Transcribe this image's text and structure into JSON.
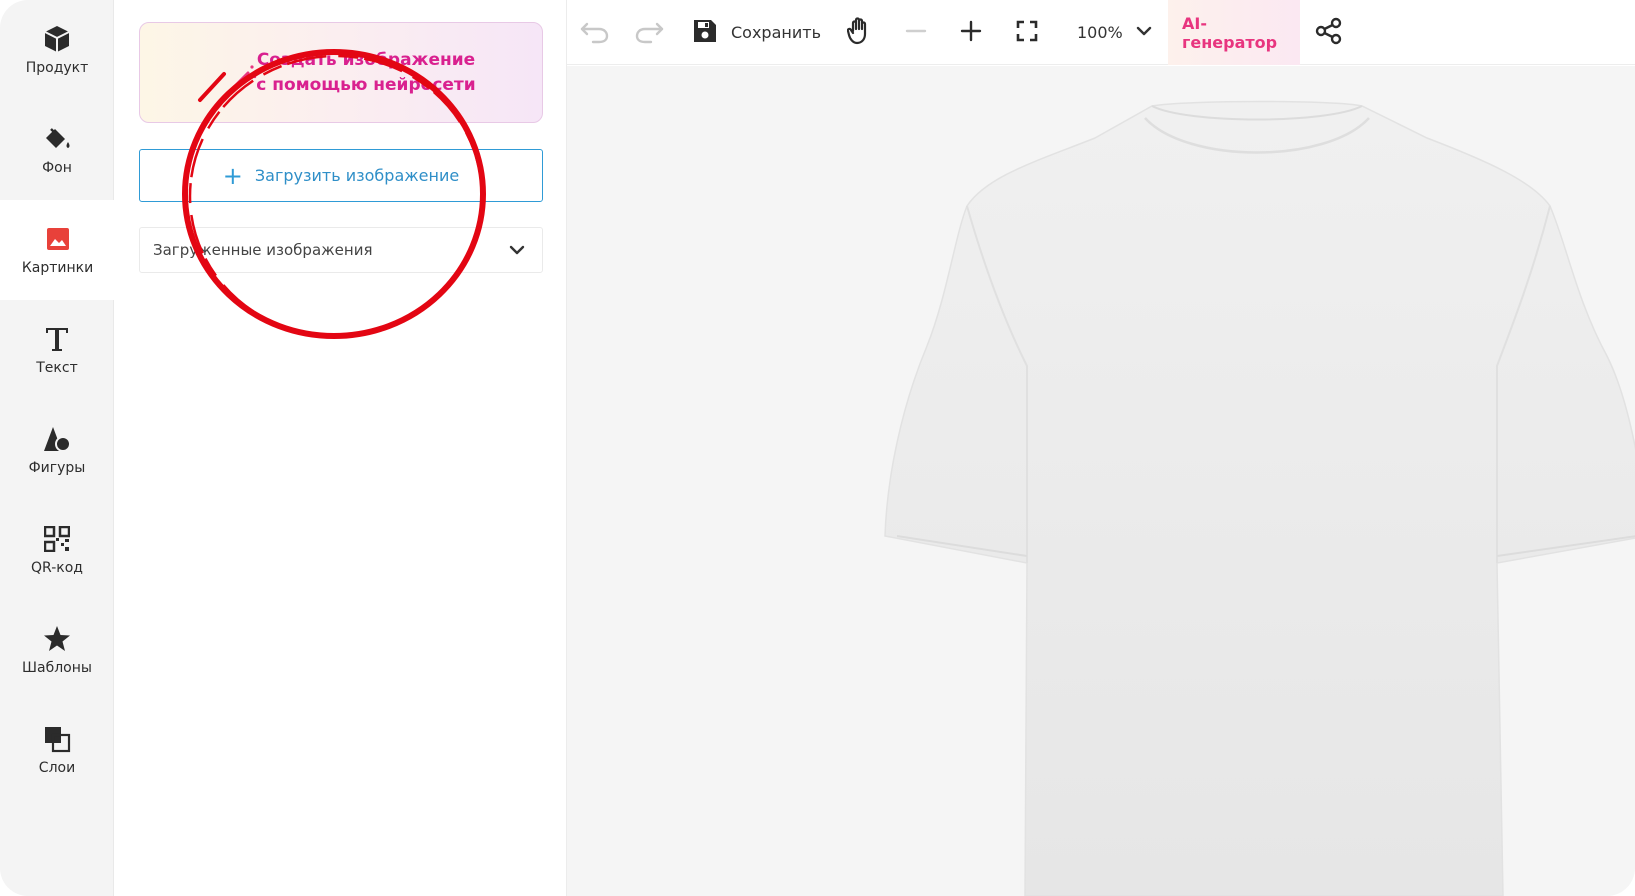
{
  "sidebar": {
    "items": [
      {
        "label": "Продукт",
        "icon": "cube-icon"
      },
      {
        "label": "Фон",
        "icon": "paint-bucket-icon"
      },
      {
        "label": "Картинки",
        "icon": "image-icon",
        "active": true
      },
      {
        "label": "Текст",
        "icon": "text-t-icon"
      },
      {
        "label": "Фигуры",
        "icon": "shapes-icon"
      },
      {
        "label": "QR-код",
        "icon": "qr-code-icon"
      },
      {
        "label": "Шаблоны",
        "icon": "star-icon"
      },
      {
        "label": "Слои",
        "icon": "layers-icon"
      }
    ]
  },
  "panel": {
    "ai_card": {
      "line1": "Создать изображение",
      "line2": "с помощью нейросети"
    },
    "upload_label": "Загрузить изображение",
    "uploaded_dropdown": "Загруженные изображения"
  },
  "toolbar": {
    "save_label": "Сохранить",
    "zoom": "100%",
    "ai_generator_label": "AI-генератор"
  },
  "colors": {
    "accent_blue": "#2f9bd6",
    "ai_pink": "#e8357f",
    "active_image_icon": "#e8413a",
    "annotation_red": "#e30613"
  }
}
